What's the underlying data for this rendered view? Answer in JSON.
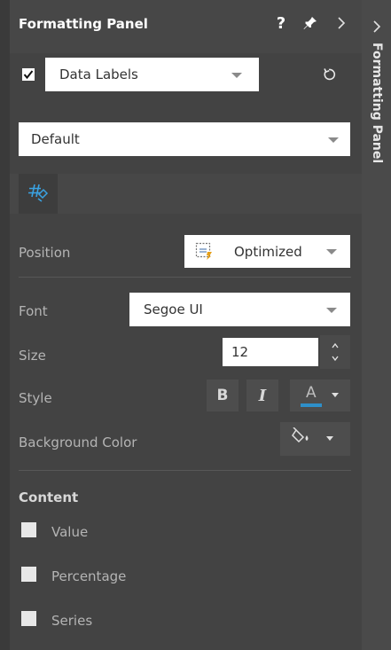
{
  "header": {
    "title": "Formatting Panel",
    "help_label": "?"
  },
  "target": {
    "checked": true,
    "dropdown_value": "Data Labels"
  },
  "scope": {
    "dropdown_value": "Default"
  },
  "tabs": [
    {
      "icon": "format-numbers-icon",
      "active": true
    }
  ],
  "position": {
    "label": "Position",
    "value": "Optimized",
    "icon": "optimized-position-icon"
  },
  "font": {
    "label": "Font",
    "value": "Segoe UI"
  },
  "size": {
    "label": "Size",
    "value": "12"
  },
  "style": {
    "label": "Style",
    "bold": "B",
    "italic": "I",
    "font_color_letter": "A",
    "font_color": "#2e8fc9"
  },
  "background_color": {
    "label": "Background Color"
  },
  "content": {
    "title": "Content",
    "items": [
      {
        "label": "Value",
        "checked": false
      },
      {
        "label": "Percentage",
        "checked": false
      },
      {
        "label": "Series",
        "checked": false
      }
    ]
  },
  "side_tab": {
    "label": "Formatting Panel"
  }
}
